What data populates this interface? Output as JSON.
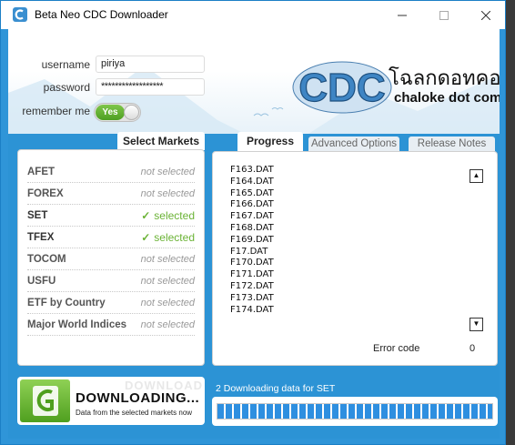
{
  "window": {
    "title": "Beta Neo CDC Downloader",
    "controls": {
      "minimize": "minimize-icon",
      "maximize": "maximize-icon",
      "close": "close-icon"
    }
  },
  "login": {
    "username_label": "username",
    "username_value": "piriya",
    "password_label": "password",
    "password_value": "******************",
    "remember_label": "remember me",
    "remember_toggle": "Yes"
  },
  "logo": {
    "letters": "CDC",
    "thai_text": "โฉลกดอทคอม",
    "subtitle": "chaloke dot com"
  },
  "markets_tab": "Select Markets",
  "markets": [
    {
      "name": "AFET",
      "status": "not selected",
      "selected": false
    },
    {
      "name": "FOREX",
      "status": "not selected",
      "selected": false
    },
    {
      "name": "SET",
      "status": "selected",
      "selected": true
    },
    {
      "name": "TFEX",
      "status": "selected",
      "selected": true
    },
    {
      "name": "TOCOM",
      "status": "not selected",
      "selected": false
    },
    {
      "name": "USFU",
      "status": "not selected",
      "selected": false
    },
    {
      "name": "ETF by Country",
      "status": "not selected",
      "selected": false
    },
    {
      "name": "Major World Indices",
      "status": "not selected",
      "selected": false
    }
  ],
  "tabs": {
    "progress": "Progress",
    "advanced": "Advanced Options",
    "release": "Release Notes"
  },
  "files": [
    "F163.DAT",
    "F164.DAT",
    "F165.DAT",
    "F166.DAT",
    "F167.DAT",
    "F168.DAT",
    "F169.DAT",
    "F17.DAT",
    "F170.DAT",
    "F171.DAT",
    "F172.DAT",
    "F173.DAT",
    "F174.DAT"
  ],
  "error": {
    "label": "Error code",
    "value": "0"
  },
  "download": {
    "ghost_text": "DOWNLOAD",
    "title": "DOWNLOADING...",
    "subtitle": "Data from the selected markets now"
  },
  "status_text": "2 Downloading data for SET",
  "progress_fraction": 1.0,
  "colors": {
    "window_blue": "#2c93d5",
    "selected_green": "#6bb336",
    "progress_blue": "#2e8fe0"
  }
}
